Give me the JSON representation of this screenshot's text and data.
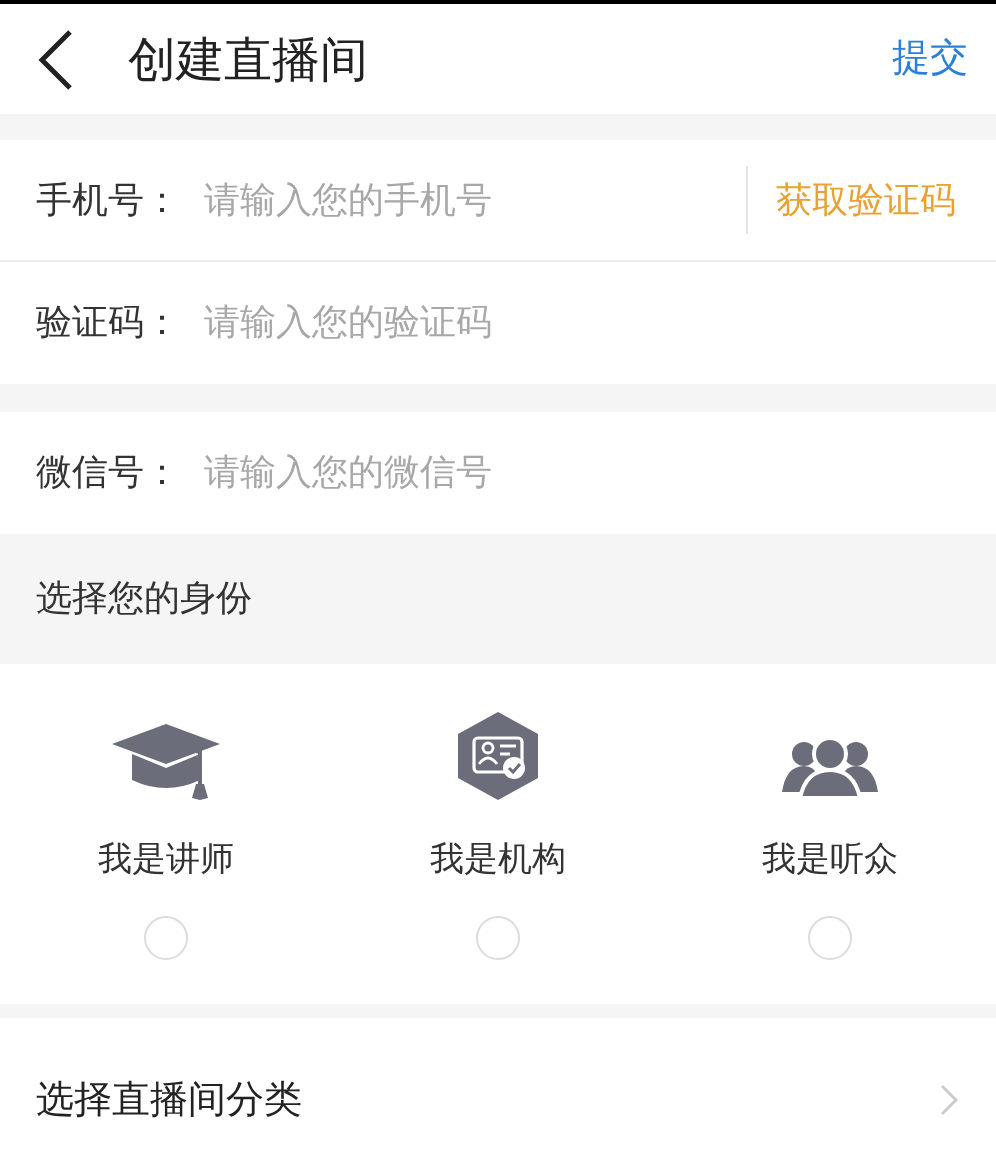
{
  "header": {
    "title": "创建直播间",
    "submit": "提交"
  },
  "fields": [
    {
      "label": "手机号：",
      "placeholder": "请输入您的手机号",
      "action": "获取验证码"
    },
    {
      "label": "验证码：",
      "placeholder": "请输入您的验证码"
    }
  ],
  "wechat": {
    "label": "微信号：",
    "placeholder": "请输入您的微信号"
  },
  "identity": {
    "title": "选择您的身份",
    "roles": [
      {
        "kind": "teacher",
        "label": "我是讲师",
        "selected": false
      },
      {
        "kind": "organization",
        "label": "我是机构",
        "selected": false
      },
      {
        "kind": "audience",
        "label": "我是听众",
        "selected": false
      }
    ]
  },
  "category": {
    "label": "选择直播间分类"
  }
}
